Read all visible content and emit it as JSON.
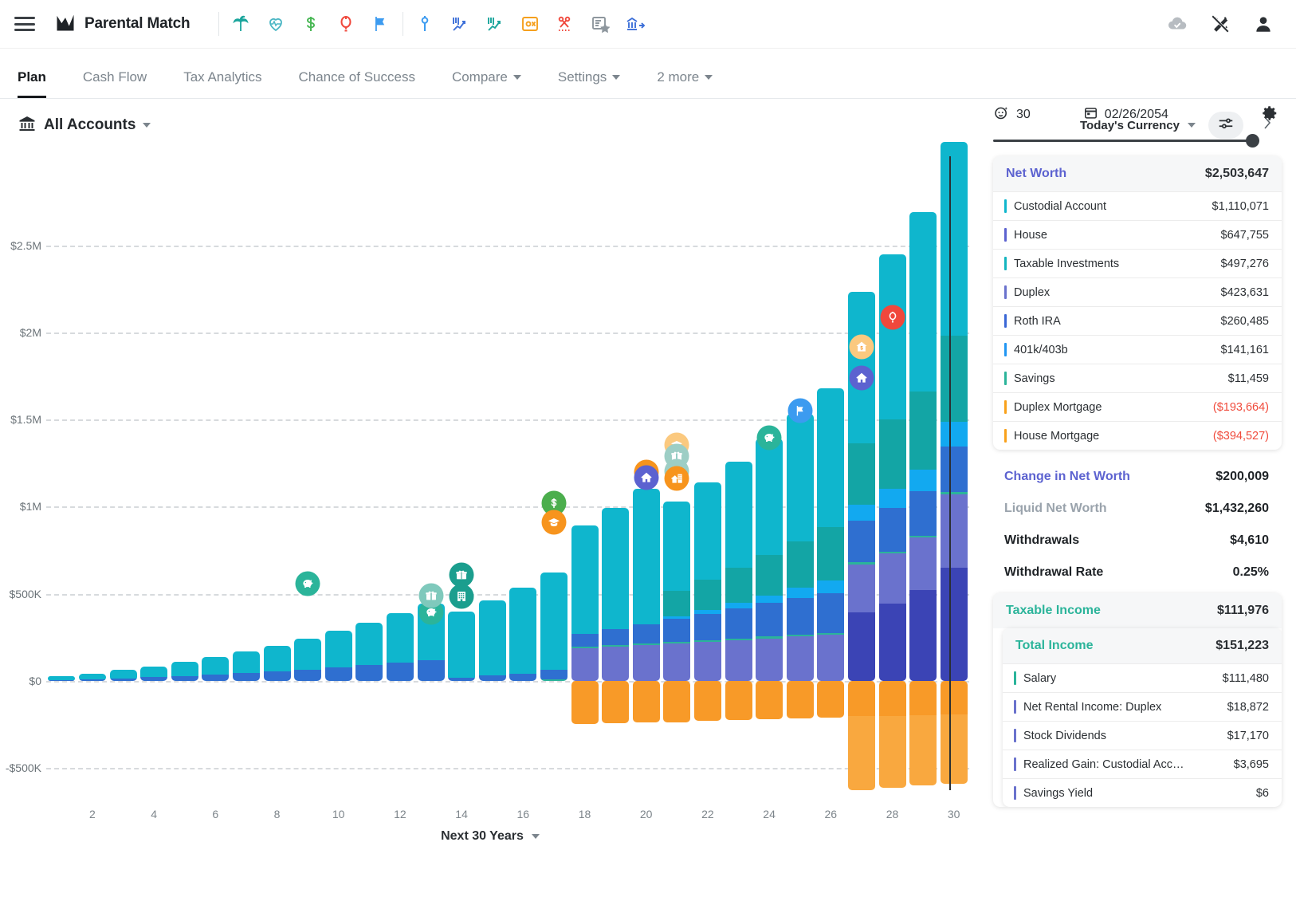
{
  "app": {
    "title": "Parental Match",
    "menu_icon": "hamburger-menu-icon",
    "logo_icon": "line-chart-logo-icon"
  },
  "toolbar": {
    "group1": [
      {
        "name": "palm-tree-icon",
        "label": "Retirement",
        "color": "#1aa59c"
      },
      {
        "name": "heart-pulse-icon",
        "label": "Health",
        "color": "#4bb6c4"
      },
      {
        "name": "dollar-sign-icon",
        "label": "Income",
        "color": "#4bb857"
      },
      {
        "name": "balloon-icon",
        "label": "Event",
        "color": "#f0483c"
      },
      {
        "name": "flag-icon",
        "label": "Milestone",
        "color": "#3c9bf0"
      }
    ],
    "group2": [
      {
        "name": "pin-marker-icon",
        "label": "Marker",
        "color": "#3c9bf0"
      },
      {
        "name": "chart-drop-icon",
        "label": "Market Drop",
        "color": "#3c6fd8"
      },
      {
        "name": "chart-rise-icon",
        "label": "Market Rise",
        "color": "#1aa59c"
      },
      {
        "name": "tax-remove-icon",
        "label": "Tax Exclusion",
        "color": "#f5a01e"
      },
      {
        "name": "scissors-cut-icon",
        "label": "Expense Cut",
        "color": "#f0483c"
      },
      {
        "name": "certificate-star-icon",
        "label": "Benefit",
        "color": "#8e979e"
      },
      {
        "name": "bank-transfer-icon",
        "label": "Transfer",
        "color": "#3c6fd8"
      }
    ],
    "right": [
      {
        "name": "cloud-check-icon",
        "label": "Saved"
      },
      {
        "name": "magic-wand-off-icon",
        "label": "Auto-Adjust Off"
      },
      {
        "name": "user-account-icon",
        "label": "Account"
      }
    ]
  },
  "nav": {
    "tabs": [
      {
        "label": "Plan",
        "active": true,
        "dropdown": false
      },
      {
        "label": "Cash Flow",
        "active": false,
        "dropdown": false
      },
      {
        "label": "Tax Analytics",
        "active": false,
        "dropdown": false
      },
      {
        "label": "Chance of Success",
        "active": false,
        "dropdown": false
      },
      {
        "label": "Compare",
        "active": false,
        "dropdown": true
      },
      {
        "label": "Settings",
        "active": false,
        "dropdown": true
      },
      {
        "label": "2 more",
        "active": false,
        "dropdown": true
      }
    ]
  },
  "subbar": {
    "account_icon": "bank-building-icon",
    "account_label": "All Accounts",
    "currency_label": "Today's Currency",
    "filter_icon": "sliders-filter-icon",
    "expand_icon": "chevron-right-icon"
  },
  "timeline": {
    "age_icon": "person-age-icon",
    "age": "30",
    "date_icon": "calendar-icon",
    "date": "02/26/2054",
    "gear_icon": "gear-settings-icon",
    "slider_position_pct": 93
  },
  "chart_data": {
    "type": "bar",
    "title": "",
    "xlabel": "Next 30 Years",
    "ylabel": "",
    "ylim": [
      -500000,
      2750000
    ],
    "ytick_labels": [
      "$2.5M",
      "$2M",
      "$1.5M",
      "$1M",
      "$500K",
      "$0",
      "-$500K"
    ],
    "ytick_values": [
      2500000,
      2000000,
      1500000,
      1000000,
      500000,
      0,
      -500000
    ],
    "xtick_labels": [
      "2",
      "4",
      "6",
      "8",
      "10",
      "12",
      "14",
      "16",
      "18",
      "20",
      "22",
      "24",
      "26",
      "28",
      "30"
    ],
    "x": [
      1,
      2,
      3,
      4,
      5,
      6,
      7,
      8,
      9,
      10,
      11,
      12,
      13,
      14,
      15,
      16,
      17,
      18,
      19,
      20,
      21,
      22,
      23,
      24,
      25,
      26,
      27,
      28,
      29,
      30
    ],
    "grid": true,
    "stacked": true,
    "legend_position": "none",
    "series": [
      {
        "name": "Custodial Account",
        "color": "#0fb6cd",
        "values": [
          22000,
          33000,
          47000,
          62000,
          80000,
          100000,
          122000,
          148000,
          176000,
          208000,
          244000,
          284000,
          328000,
          378000,
          432000,
          492000,
          556000,
          624000,
          698000,
          778000,
          512000,
          560000,
          612000,
          668000,
          730000,
          796000,
          868000,
          946000,
          1028000,
          1110071
        ]
      },
      {
        "name": "Taxable Investments",
        "color": "#13a5a5",
        "values": [
          0,
          0,
          0,
          0,
          0,
          0,
          0,
          0,
          0,
          0,
          0,
          0,
          0,
          0,
          0,
          0,
          0,
          0,
          0,
          0,
          146000,
          172000,
          200000,
          232000,
          268000,
          308000,
          352000,
          400000,
          448000,
          497276
        ]
      },
      {
        "name": "401k/403b",
        "color": "#12a9f0",
        "values": [
          0,
          0,
          0,
          0,
          0,
          0,
          0,
          0,
          0,
          0,
          0,
          0,
          0,
          0,
          0,
          0,
          0,
          0,
          0,
          0,
          14000,
          22000,
          32000,
          44000,
          58000,
          74000,
          92000,
          110000,
          126000,
          141161
        ]
      },
      {
        "name": "Roth IRA",
        "color": "#2f6fd0",
        "values": [
          4000,
          9000,
          15000,
          21000,
          28000,
          36000,
          45000,
          55000,
          66000,
          78000,
          91000,
          104000,
          118000,
          20000,
          30000,
          42000,
          56000,
          72000,
          90000,
          110000,
          132000,
          152000,
          172000,
          192000,
          210000,
          226000,
          240000,
          250000,
          256000,
          260485
        ]
      },
      {
        "name": "Savings",
        "color": "#2bb49a",
        "values": [
          0,
          0,
          0,
          0,
          0,
          0,
          0,
          0,
          0,
          0,
          0,
          0,
          0,
          0,
          0,
          0,
          8000,
          9000,
          9500,
          10000,
          10400,
          10700,
          11000,
          11100,
          11200,
          11300,
          11350,
          11400,
          11430,
          11459
        ]
      },
      {
        "name": "Duplex",
        "color": "#6a72cd",
        "values": [
          0,
          0,
          0,
          0,
          0,
          0,
          0,
          0,
          0,
          0,
          0,
          0,
          0,
          0,
          0,
          0,
          0,
          188000,
          196000,
          205000,
          214000,
          223000,
          233000,
          243000,
          254000,
          265000,
          277000,
          289000,
          301000,
          423631
        ]
      },
      {
        "name": "House",
        "color": "#3b44b5",
        "values": [
          0,
          0,
          0,
          0,
          0,
          0,
          0,
          0,
          0,
          0,
          0,
          0,
          0,
          0,
          0,
          0,
          0,
          0,
          0,
          0,
          0,
          0,
          0,
          0,
          0,
          0,
          392000,
          442000,
          520000,
          647755
        ]
      },
      {
        "name": "Duplex Mortgage",
        "color": "#f89a28",
        "values": [
          0,
          0,
          0,
          0,
          0,
          0,
          0,
          0,
          0,
          0,
          0,
          0,
          0,
          0,
          0,
          0,
          0,
          -248000,
          -244000,
          -240000,
          -236000,
          -231000,
          -226000,
          -221000,
          -215000,
          -209000,
          -203000,
          -200000,
          -197000,
          -193664
        ]
      },
      {
        "name": "House Mortgage",
        "color": "#f9a83f",
        "values": [
          0,
          0,
          0,
          0,
          0,
          0,
          0,
          0,
          0,
          0,
          0,
          0,
          0,
          0,
          0,
          0,
          0,
          0,
          0,
          0,
          0,
          0,
          0,
          0,
          0,
          0,
          -424000,
          -414000,
          -404000,
          -394527
        ]
      }
    ],
    "markers": [
      {
        "name": "piggy-bank-icon",
        "label": "Savings Goal",
        "x": 9,
        "value": 560000,
        "color": "#2bb49a",
        "faded": false
      },
      {
        "name": "piggy-bank-icon",
        "label": "Savings Goal",
        "x": 13,
        "value": 395000,
        "color": "#2bb49a",
        "faded": true
      },
      {
        "name": "gift-icon",
        "label": "Gift",
        "x": 13,
        "value": 490000,
        "color": "#7fc9bc",
        "faded": true
      },
      {
        "name": "gift-icon",
        "label": "Gift",
        "x": 14,
        "value": 610000,
        "color": "#1b9e8e",
        "faded": false
      },
      {
        "name": "office-building-icon",
        "label": "Property",
        "x": 14,
        "value": 485000,
        "color": "#1b9e8e",
        "faded": false
      },
      {
        "name": "dollar-coin-icon",
        "label": "Income Event",
        "x": 17,
        "value": 1020000,
        "color": "#4bae4d",
        "faded": false
      },
      {
        "name": "graduation-cap-icon",
        "label": "Education",
        "x": 17,
        "value": 910000,
        "color": "#f7941d",
        "faded": false
      },
      {
        "name": "home-sale-icon",
        "label": "Home Sale",
        "x": 20,
        "value": 1200000,
        "color": "#f7941d",
        "faded": false
      },
      {
        "name": "house-icon",
        "label": "Home Purchase",
        "x": 20,
        "value": 1165000,
        "color": "#5c62d0",
        "faded": false
      },
      {
        "name": "graduation-cap-icon",
        "label": "Education",
        "x": 21,
        "value": 1355000,
        "color": "#fbc97f",
        "faded": true
      },
      {
        "name": "gift-icon",
        "label": "Gift",
        "x": 21,
        "value": 1290000,
        "color": "#9dcec5",
        "faded": true
      },
      {
        "name": "office-building-icon",
        "label": "Property",
        "x": 21,
        "value": 1205000,
        "color": "#9dcec5",
        "faded": true
      },
      {
        "name": "rental-property-icon",
        "label": "Rental Property",
        "x": 21,
        "value": 1160000,
        "color": "#f7941d",
        "faded": false
      },
      {
        "name": "piggy-bank-icon",
        "label": "Savings Goal",
        "x": 24,
        "value": 1395000,
        "color": "#2bb49a",
        "faded": false
      },
      {
        "name": "flag-icon",
        "label": "Milestone",
        "x": 25,
        "value": 1550000,
        "color": "#3c9bf0",
        "faded": false
      },
      {
        "name": "house-icon",
        "label": "Home Purchase",
        "x": 27,
        "value": 1740000,
        "color": "#5c62d0",
        "faded": false
      },
      {
        "name": "home-sale-icon",
        "label": "Home Sale",
        "x": 27,
        "value": 1915000,
        "color": "#fbc97f",
        "faded": true
      },
      {
        "name": "balloon-icon",
        "label": "Life Event",
        "x": 28,
        "value": 2085000,
        "color": "#f0483c",
        "faded": false
      }
    ],
    "cursor_x": 30
  },
  "net_worth_card": {
    "title": "Net Worth",
    "total": "$2,503,647",
    "rows": [
      {
        "label": "Custodial Account",
        "value": "$1,110,071",
        "color": "#0fb6cd",
        "negative": false
      },
      {
        "label": "House",
        "value": "$647,755",
        "color": "#5c62d0",
        "negative": false
      },
      {
        "label": "Taxable Investments",
        "value": "$497,276",
        "color": "#13b5bf",
        "negative": false
      },
      {
        "label": "Duplex",
        "value": "$423,631",
        "color": "#6a72cd",
        "negative": false
      },
      {
        "label": "Roth IRA",
        "value": "$260,485",
        "color": "#3a67d6",
        "negative": false
      },
      {
        "label": "401k/403b",
        "value": "$141,161",
        "color": "#2196f3",
        "negative": false
      },
      {
        "label": "Savings",
        "value": "$11,459",
        "color": "#2bb49a",
        "negative": false
      },
      {
        "label": "Duplex Mortgage",
        "value": "($193,664)",
        "color": "#f9a11b",
        "negative": true
      },
      {
        "label": "House Mortgage",
        "value": "($394,527)",
        "color": "#f9a11b",
        "negative": true
      }
    ]
  },
  "stats": [
    {
      "label": "Change in Net Worth",
      "value": "$200,009",
      "style": "purple"
    },
    {
      "label": "Liquid Net Worth",
      "value": "$1,432,260",
      "style": "grey"
    },
    {
      "label": "Withdrawals",
      "value": "$4,610",
      "style": "dark"
    },
    {
      "label": "Withdrawal Rate",
      "value": "0.25%",
      "style": "dark"
    }
  ],
  "taxable_income_card": {
    "title": "Taxable Income",
    "total": "$111,976"
  },
  "total_income_card": {
    "title": "Total Income",
    "total": "$151,223",
    "rows": [
      {
        "label": "Salary",
        "value": "$111,480",
        "color": "#2bb49a"
      },
      {
        "label": "Net Rental Income: Duplex",
        "value": "$18,872",
        "color": "#6a72cd"
      },
      {
        "label": "Stock Dividends",
        "value": "$17,170",
        "color": "#6a72cd"
      },
      {
        "label": "Realized Gain: Custodial Accou…",
        "value": "$3,695",
        "color": "#6a72cd"
      },
      {
        "label": "Savings Yield",
        "value": "$6",
        "color": "#6a72cd"
      }
    ]
  }
}
